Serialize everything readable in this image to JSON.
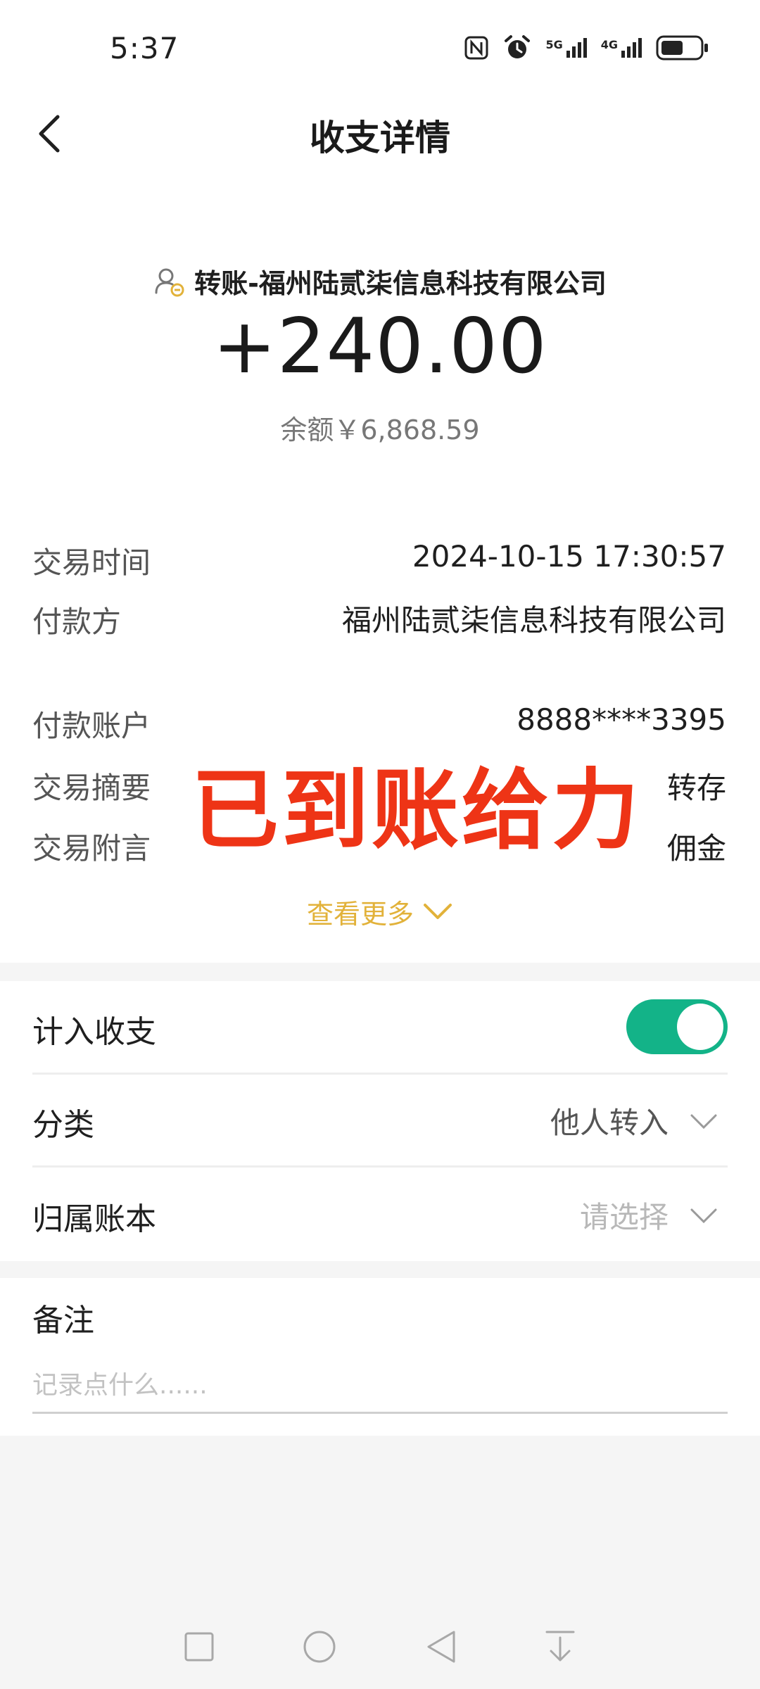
{
  "status_bar": {
    "time": "5:37",
    "icons": [
      "nfc-icon",
      "alarm-icon",
      "signal-5g-icon",
      "signal-4g-icon",
      "battery-icon"
    ],
    "network_labels": [
      "5G",
      "4G"
    ]
  },
  "header": {
    "title": "收支详情"
  },
  "summary": {
    "counterparty": "转账-福州陆贰柒信息科技有限公司",
    "amount": "+240.00",
    "balance": "余额￥6,868.59"
  },
  "details": {
    "time_label": "交易时间",
    "time_value": "2024-10-15 17:30:57",
    "payer_label": "付款方",
    "payer_value": "福州陆贰柒信息科技有限公司",
    "account_label": "付款账户",
    "account_value": "8888****3395",
    "summary_label": "交易摘要",
    "summary_value": "转存",
    "remark_label": "交易附言",
    "remark_value": "佣金",
    "more_label": "查看更多"
  },
  "overlay_text": "已到账给力",
  "settings": {
    "include_label": "计入收支",
    "include_on": true,
    "category_label": "分类",
    "category_value": "他人转入",
    "book_label": "归属账本",
    "book_placeholder": "请选择"
  },
  "note": {
    "label": "备注",
    "placeholder": "记录点什么......"
  },
  "colors": {
    "accent_gold": "#e2b23a",
    "toggle_green": "#13b388",
    "overlay_red": "#ee3416"
  }
}
